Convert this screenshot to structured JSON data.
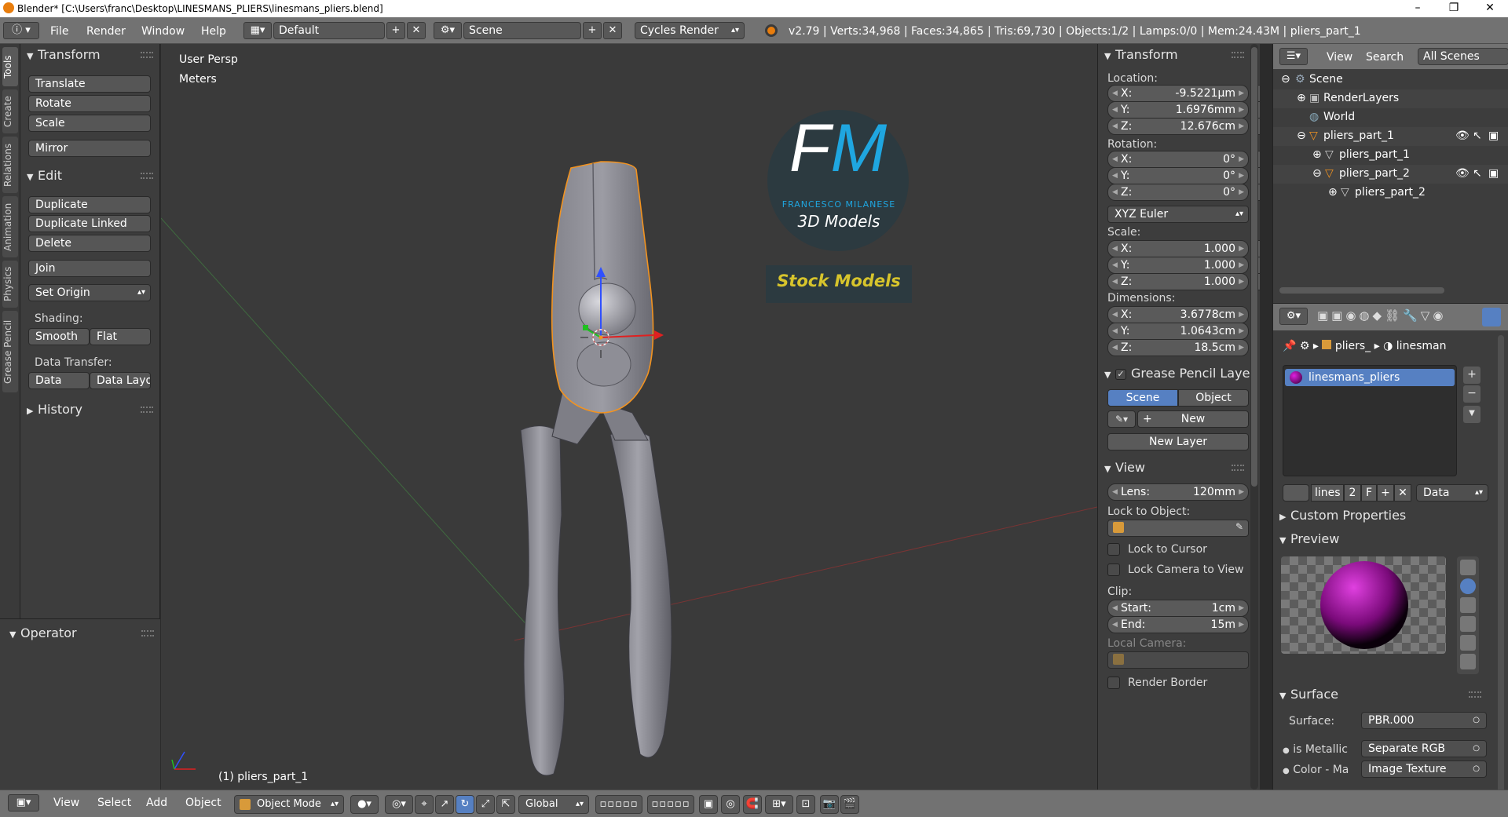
{
  "window": {
    "title": "Blender* [C:\\Users\\franc\\Desktop\\LINESMANS_PLIERS\\linesmans_pliers.blend]",
    "minimize": "–",
    "maximize": "❐",
    "close": "✕"
  },
  "info_header": {
    "menus": [
      "File",
      "Render",
      "Window",
      "Help"
    ],
    "layout": "Default",
    "scene": "Scene",
    "engine": "Cycles Render",
    "stats": "v2.79 | Verts:34,968 | Faces:34,865 | Tris:69,730 | Objects:1/2 | Lamps:0/0 | Mem:24.43M | pliers_part_1"
  },
  "left_tabs": [
    "Tools",
    "Create",
    "Relations",
    "Animation",
    "Physics",
    "Grease Pencil"
  ],
  "tool_shelf": {
    "transform_title": "Transform",
    "transform_buttons": [
      "Translate",
      "Rotate",
      "Scale",
      "Mirror"
    ],
    "edit_title": "Edit",
    "edit_buttons": [
      "Duplicate",
      "Duplicate Linked",
      "Delete",
      "Join"
    ],
    "set_origin": "Set Origin",
    "shading_label": "Shading:",
    "smooth": "Smooth",
    "flat": "Flat",
    "data_transfer_label": "Data Transfer:",
    "data": "Data",
    "data_layout": "Data Layo",
    "history_title": "History",
    "operator_title": "Operator"
  },
  "viewport": {
    "view_name": "User Persp",
    "units": "Meters",
    "selected_label": "(1) pliers_part_1",
    "logo_fm": "FM",
    "logo_name": "FRANCESCO MILANESE",
    "logo_sub": "3D Models",
    "logo_stock": "Stock Models"
  },
  "n_panel": {
    "transform_title": "Transform",
    "location_label": "Location:",
    "location": [
      {
        "k": "X:",
        "v": "-9.5221μm"
      },
      {
        "k": "Y:",
        "v": "1.6976mm"
      },
      {
        "k": "Z:",
        "v": "12.676cm"
      }
    ],
    "rotation_label": "Rotation:",
    "rotation": [
      {
        "k": "X:",
        "v": "0°"
      },
      {
        "k": "Y:",
        "v": "0°"
      },
      {
        "k": "Z:",
        "v": "0°"
      }
    ],
    "rotation_mode": "XYZ Euler",
    "scale_label": "Scale:",
    "scale": [
      {
        "k": "X:",
        "v": "1.000"
      },
      {
        "k": "Y:",
        "v": "1.000"
      },
      {
        "k": "Z:",
        "v": "1.000"
      }
    ],
    "dimensions_label": "Dimensions:",
    "dimensions": [
      {
        "k": "X:",
        "v": "3.6778cm"
      },
      {
        "k": "Y:",
        "v": "1.0643cm"
      },
      {
        "k": "Z:",
        "v": "18.5cm"
      }
    ],
    "grease_title": "Grease Pencil Layer",
    "scene_tab": "Scene",
    "object_tab": "Object",
    "new": "New",
    "new_layer": "New Layer",
    "view_title": "View",
    "lens_label": "Lens:",
    "lens_value": "120mm",
    "lock_object_label": "Lock to Object:",
    "lock_cursor": "Lock to Cursor",
    "lock_camera": "Lock Camera to View",
    "clip_label": "Clip:",
    "clip_start_label": "Start:",
    "clip_start": "1cm",
    "clip_end_label": "End:",
    "clip_end": "15m",
    "local_camera": "Local Camera:",
    "render_border": "Render Border"
  },
  "outliner": {
    "view": "View",
    "search": "Search",
    "all_scenes": "All Scenes",
    "items": [
      "Scene",
      "RenderLayers",
      "World",
      "pliers_part_1",
      "pliers_part_1",
      "pliers_part_2",
      "pliers_part_2"
    ]
  },
  "properties": {
    "breadcrumb_obj": "pliers_",
    "breadcrumb_mat": "linesman",
    "material_slot": "linesmans_pliers",
    "mat_name": "lines",
    "users": "2",
    "fake": "F",
    "link": "Data",
    "custom_props": "Custom Properties",
    "preview": "Preview",
    "surface_title": "Surface",
    "surface_label": "Surface:",
    "surface_value": "PBR.000",
    "metallic_label": "is Metallic",
    "metallic_value": "Separate RGB",
    "color_label": "Color - Ma",
    "color_value": "Image Texture"
  },
  "bottom_header": {
    "menus": [
      "View",
      "Select",
      "Add",
      "Object"
    ],
    "mode": "Object Mode",
    "orientation": "Global"
  },
  "colors": {
    "accent_blue": "#5680c2",
    "selection_orange": "#f29320",
    "logo_cyan": "#1fa6e0",
    "logo_yellow": "#d7c42c"
  }
}
